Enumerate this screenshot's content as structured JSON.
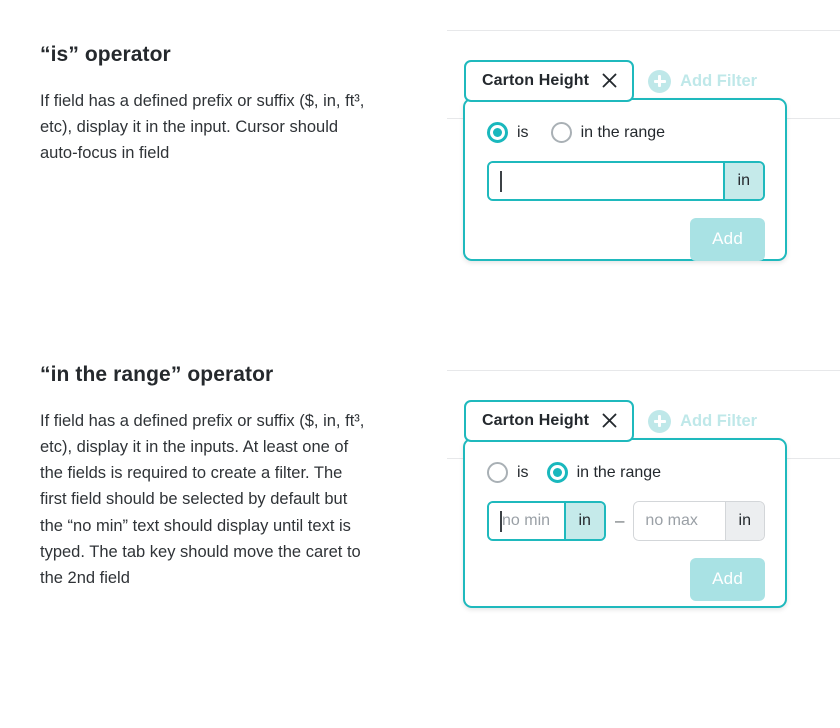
{
  "sections": [
    {
      "title": "“is” operator",
      "body": "If field has a defined prefix or suffix ($, in, ft³, etc), display it in the input. Cursor should auto-focus in field",
      "mock": {
        "chip_label": "Carton Height",
        "chip_close_icon": "close-icon",
        "add_filter_label": "Add Filter",
        "add_filter_icon": "plus-circle-icon",
        "radios": [
          {
            "label": "is",
            "selected": true
          },
          {
            "label": "in the range",
            "selected": false
          }
        ],
        "fields": [
          {
            "name": "value",
            "value": "",
            "placeholder": "",
            "suffix": "in",
            "focused": true
          }
        ],
        "submit_label": "Add"
      }
    },
    {
      "title": "“in the range” operator",
      "body": "If field has a defined prefix or suffix ($, in, ft³, etc), display it in the inputs. At least one of the fields is required to create a filter. The first field should be selected by default but the “no min” text should display until text is typed. The tab key should move the caret to the 2nd field",
      "mock": {
        "chip_label": "Carton Height",
        "chip_close_icon": "close-icon",
        "add_filter_label": "Add Filter",
        "add_filter_icon": "plus-circle-icon",
        "radios": [
          {
            "label": "is",
            "selected": false
          },
          {
            "label": "in the range",
            "selected": true
          }
        ],
        "separator": "–",
        "fields": [
          {
            "name": "min",
            "value": "",
            "placeholder": "no min",
            "suffix": "in",
            "focused": true
          },
          {
            "name": "max",
            "value": "",
            "placeholder": "no max",
            "suffix": "in",
            "focused": false
          }
        ],
        "submit_label": "Add"
      }
    }
  ],
  "colors": {
    "accent_teal": "#1fb9bd",
    "accent_teal_light": "#c5eaea",
    "disabled_teal": "#a9e2e4",
    "add_filter_teal": "#bfe8e9",
    "text": "#24292e",
    "placeholder": "#9aa0a6",
    "rule": "#e7e8ea",
    "idle_border": "#d3d6d9",
    "radio_off_border": "#a9b0b5"
  }
}
